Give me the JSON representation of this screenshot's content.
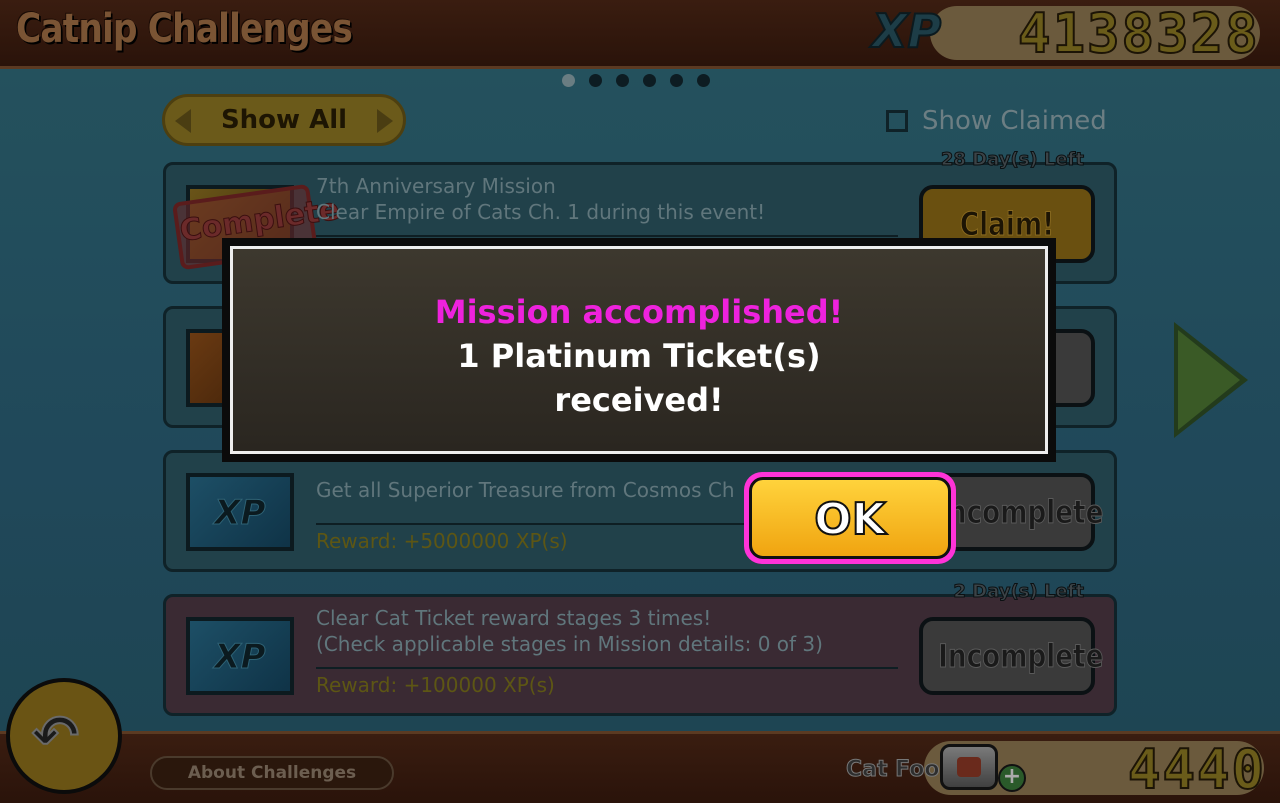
{
  "header": {
    "title": "Catnip Challenges",
    "xp_label": "XP",
    "xp_value": "4138328"
  },
  "pager": {
    "total": 6,
    "active_index": 0
  },
  "filter": {
    "label": "Show All"
  },
  "show_claimed": {
    "label": "Show Claimed",
    "checked": false
  },
  "missions": [
    {
      "thumb": "anniversary-image",
      "stamp": "Complete",
      "title_lines": [
        "7th Anniversary Mission",
        "Clear Empire of Cats Ch. 1 during this event!"
      ],
      "reward": "",
      "days_left": "28 Day(s) Left",
      "button": "Claim!"
    },
    {
      "thumb": "cat-food-image",
      "title_lines": [],
      "reward": "",
      "days_left": "",
      "button": ""
    },
    {
      "thumb": "xp-image",
      "thumb_text": "XP",
      "title_lines": [
        "Get all Superior Treasure from Cosmos Ch"
      ],
      "reward": "Reward: +5000000 XP(s)",
      "days_left": "",
      "button": "Incomplete"
    },
    {
      "thumb": "xp-image",
      "thumb_text": "XP",
      "title_lines": [
        "Clear Cat Ticket reward stages 3 times!",
        "(Check applicable stages in Mission details: 0 of 3)"
      ],
      "reward": "Reward: +100000 XP(s)",
      "days_left": "2 Day(s) Left",
      "button": "Incomplete"
    }
  ],
  "dialog": {
    "line1": "Mission accomplished!",
    "line2": "1 Platinum Ticket(s)",
    "line3": "received!",
    "ok_label": "OK",
    "title_color": "#ee22dd"
  },
  "footer": {
    "about_label": "About Challenges",
    "catfood_label": "Cat Food",
    "catfood_value": "4440"
  },
  "icons": {
    "back": "back-arrow-icon",
    "next": "next-page-arrow-icon",
    "catfood": "cat-food-can-icon",
    "add": "plus-icon"
  }
}
